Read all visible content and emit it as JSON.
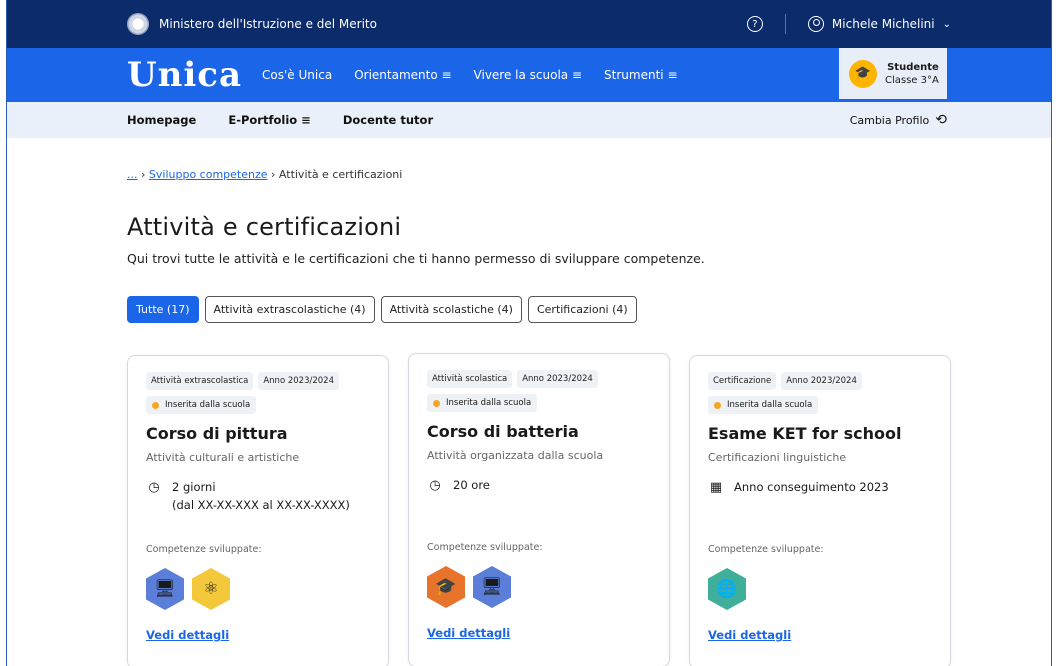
{
  "topbar": {
    "ministry": "Ministero dell'Istruzione e del Merito",
    "help_icon": "question-circle-icon",
    "user_name": "Michele Michelini"
  },
  "mainbar": {
    "logo": "Unica",
    "nav": [
      "Cos'è Unica",
      "Orientamento ≡",
      "Vivere la scuola ≡",
      "Strumenti ≡"
    ],
    "profile": {
      "role": "Studente",
      "class": "Classe 3°A",
      "icon": "graduation-cap-icon"
    }
  },
  "subbar": {
    "items": [
      "Homepage",
      "E-Portfolio ≡",
      "Docente tutor"
    ],
    "switch_profile": "Cambia Profilo"
  },
  "breadcrumb": {
    "ellipsis": "...",
    "sep1": "›",
    "parent": "Sviluppo competenze",
    "sep2": "›",
    "current": "Attività e certificazioni"
  },
  "page": {
    "title": "Attività e certificazioni",
    "intro": "Qui trovi tutte le attività e le certificazioni che ti hanno permesso di sviluppare competenze."
  },
  "filters": [
    "Tutte (17)",
    "Attività extrascolastiche (4)",
    "Attività scolastiche (4)",
    "Certificazioni (4)"
  ],
  "cards": [
    {
      "tag1": "Attività extrascolastica",
      "tag2": "Anno 2023/2024",
      "status": "Inserita dalla scuola",
      "title": "Corso di pittura",
      "subtitle": "Attività culturali e artistiche",
      "detail_icon": "clock-icon",
      "detail": "2 giorni",
      "detail2": "(dal XX-XX-XXX al XX-XX-XXXX)",
      "skills_label": "Competenze sviluppate:",
      "link": "Vedi dettagli"
    },
    {
      "tag1": "Attività scolastica",
      "tag2": "Anno 2023/2024",
      "status": "Inserita dalla scuola",
      "title": "Corso di batteria",
      "subtitle": "Attività organizzata dalla scuola",
      "detail_icon": "clock-icon",
      "detail": "20 ore",
      "skills_label": "Competenze sviluppate:",
      "link": "Vedi dettagli"
    },
    {
      "tag1": "Certificazione",
      "tag2": "Anno 2023/2024",
      "status": "Inserita dalla scuola",
      "title": "Esame KET for school",
      "subtitle": "Certificazioni linguistiche",
      "detail_icon": "calendar-icon",
      "detail": "Anno conseguimento 2023",
      "skills_label": "Competenze sviluppate:",
      "link": "Vedi dettagli"
    }
  ],
  "colors": {
    "topbar": "#0b2b6b",
    "primary": "#1b66e8",
    "subbar": "#eaf0f9",
    "accent": "#ffb400"
  }
}
